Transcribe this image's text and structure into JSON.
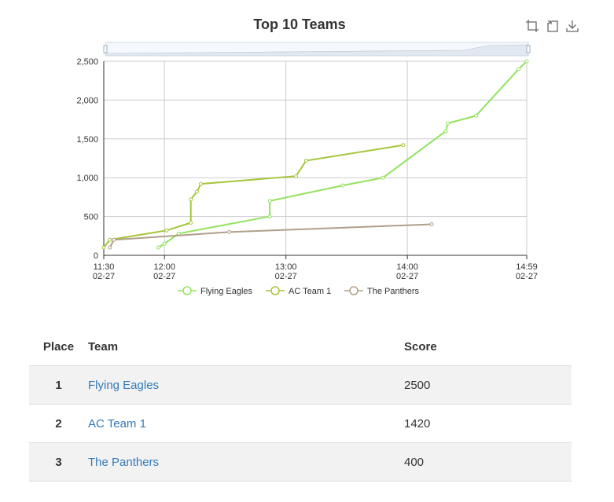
{
  "toolbox": {
    "icons": [
      "zoom-icon",
      "zoom-reset-icon",
      "download-icon"
    ]
  },
  "table": {
    "headers": {
      "place": "Place",
      "team": "Team",
      "score": "Score"
    },
    "rows": [
      {
        "place": "1",
        "team": "Flying Eagles",
        "score": "2500"
      },
      {
        "place": "2",
        "team": "AC Team 1",
        "score": "1420"
      },
      {
        "place": "3",
        "team": "The Panthers",
        "score": "400"
      }
    ]
  },
  "chart_data": {
    "type": "line",
    "title": "Top 10 Teams",
    "xlabel": "",
    "ylabel": "",
    "x_axis_type": "time",
    "xlim": [
      "02-27 11:30",
      "02-27 14:59"
    ],
    "xticks": [
      {
        "time": "11:30",
        "date": "02-27",
        "t": "02-27 11:30"
      },
      {
        "time": "12:00",
        "date": "02-27",
        "t": "02-27 12:00"
      },
      {
        "time": "13:00",
        "date": "02-27",
        "t": "02-27 13:00"
      },
      {
        "time": "14:00",
        "date": "02-27",
        "t": "02-27 14:00"
      },
      {
        "time": "14:59",
        "date": "02-27",
        "t": "02-27 14:59"
      }
    ],
    "ylim": [
      0,
      2500
    ],
    "yticks": [
      "0",
      "500",
      "1,000",
      "1,500",
      "2,000",
      "2,500"
    ],
    "ytick_values": [
      0,
      500,
      1000,
      1500,
      2000,
      2500
    ],
    "grid": true,
    "legend_position": "bottom",
    "data_zoom_slider": true,
    "series": [
      {
        "name": "Flying Eagles",
        "color": "#91e35d",
        "points": [
          [
            "02-27 11:57",
            100
          ],
          [
            "02-27 12:00",
            150
          ],
          [
            "02-27 12:07",
            280
          ],
          [
            "02-27 12:52",
            500
          ],
          [
            "02-27 12:52",
            700
          ],
          [
            "02-27 13:28",
            900
          ],
          [
            "02-27 13:48",
            1000
          ],
          [
            "02-27 14:19",
            1600
          ],
          [
            "02-27 14:20",
            1700
          ],
          [
            "02-27 14:34",
            1800
          ],
          [
            "02-27 14:55",
            2400
          ],
          [
            "02-27 14:59",
            2500
          ]
        ]
      },
      {
        "name": "AC Team 1",
        "color": "#a4c639",
        "points": [
          [
            "02-27 11:30",
            100
          ],
          [
            "02-27 11:33",
            200
          ],
          [
            "02-27 12:01",
            320
          ],
          [
            "02-27 12:13",
            420
          ],
          [
            "02-27 12:13",
            720
          ],
          [
            "02-27 12:16",
            820
          ],
          [
            "02-27 12:18",
            920
          ],
          [
            "02-27 13:05",
            1020
          ],
          [
            "02-27 13:10",
            1220
          ],
          [
            "02-27 13:58",
            1420
          ]
        ]
      },
      {
        "name": "The Panthers",
        "color": "#b09f8a",
        "points": [
          [
            "02-27 11:33",
            100
          ],
          [
            "02-27 11:35",
            200
          ],
          [
            "02-27 12:32",
            300
          ],
          [
            "02-27 14:12",
            400
          ]
        ]
      }
    ]
  }
}
